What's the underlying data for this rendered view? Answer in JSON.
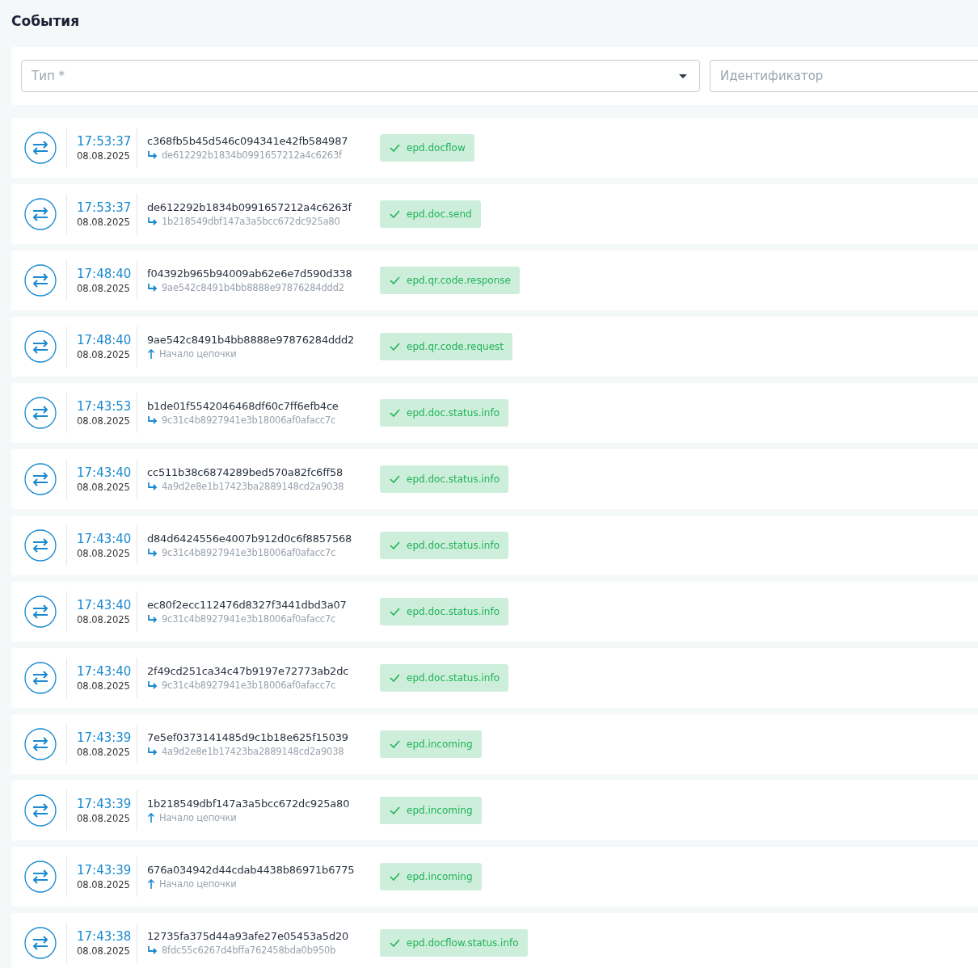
{
  "title": "События",
  "filters": {
    "type": {
      "placeholder": "Тип *"
    },
    "identifier": {
      "placeholder": "Идентификатор"
    }
  },
  "events": [
    {
      "time": "17:53:37",
      "date": "08.08.2025",
      "id": "c368fb5b45d546c094341e42fb584987",
      "link": {
        "kind": "parent",
        "text": "de612292b1834b0991657212a4c6263f"
      },
      "tag": "epd.docflow"
    },
    {
      "time": "17:53:37",
      "date": "08.08.2025",
      "id": "de612292b1834b0991657212a4c6263f",
      "link": {
        "kind": "parent",
        "text": "1b218549dbf147a3a5bcc672dc925a80"
      },
      "tag": "epd.doc.send"
    },
    {
      "time": "17:48:40",
      "date": "08.08.2025",
      "id": "f04392b965b94009ab62e6e7d590d338",
      "link": {
        "kind": "parent",
        "text": "9ae542c8491b4bb8888e97876284ddd2"
      },
      "tag": "epd.qr.code.response"
    },
    {
      "time": "17:48:40",
      "date": "08.08.2025",
      "id": "9ae542c8491b4bb8888e97876284ddd2",
      "link": {
        "kind": "chain_start",
        "text": "Начало цепочки"
      },
      "tag": "epd.qr.code.request"
    },
    {
      "time": "17:43:53",
      "date": "08.08.2025",
      "id": "b1de01f5542046468df60c7ff6efb4ce",
      "link": {
        "kind": "parent",
        "text": "9c31c4b8927941e3b18006af0afacc7c"
      },
      "tag": "epd.doc.status.info"
    },
    {
      "time": "17:43:40",
      "date": "08.08.2025",
      "id": "cc511b38c6874289bed570a82fc6ff58",
      "link": {
        "kind": "parent",
        "text": "4a9d2e8e1b17423ba2889148cd2a9038"
      },
      "tag": "epd.doc.status.info"
    },
    {
      "time": "17:43:40",
      "date": "08.08.2025",
      "id": "d84d6424556e4007b912d0c6f8857568",
      "link": {
        "kind": "parent",
        "text": "9c31c4b8927941e3b18006af0afacc7c"
      },
      "tag": "epd.doc.status.info"
    },
    {
      "time": "17:43:40",
      "date": "08.08.2025",
      "id": "ec80f2ecc112476d8327f3441dbd3a07",
      "link": {
        "kind": "parent",
        "text": "9c31c4b8927941e3b18006af0afacc7c"
      },
      "tag": "epd.doc.status.info"
    },
    {
      "time": "17:43:40",
      "date": "08.08.2025",
      "id": "2f49cd251ca34c47b9197e72773ab2dc",
      "link": {
        "kind": "parent",
        "text": "9c31c4b8927941e3b18006af0afacc7c"
      },
      "tag": "epd.doc.status.info"
    },
    {
      "time": "17:43:39",
      "date": "08.08.2025",
      "id": "7e5ef0373141485d9c1b18e625f15039",
      "link": {
        "kind": "parent",
        "text": "4a9d2e8e1b17423ba2889148cd2a9038"
      },
      "tag": "epd.incoming"
    },
    {
      "time": "17:43:39",
      "date": "08.08.2025",
      "id": "1b218549dbf147a3a5bcc672dc925a80",
      "link": {
        "kind": "chain_start",
        "text": "Начало цепочки"
      },
      "tag": "epd.incoming"
    },
    {
      "time": "17:43:39",
      "date": "08.08.2025",
      "id": "676a034942d44cdab4438b86971b6775",
      "link": {
        "kind": "chain_start",
        "text": "Начало цепочки"
      },
      "tag": "epd.incoming"
    },
    {
      "time": "17:43:38",
      "date": "08.08.2025",
      "id": "12735fa375d44a93afe27e05453a5d20",
      "link": {
        "kind": "parent",
        "text": "8fdc55c6267d4bffa762458bda0b950b"
      },
      "tag": "epd.docflow.status.info"
    }
  ]
}
